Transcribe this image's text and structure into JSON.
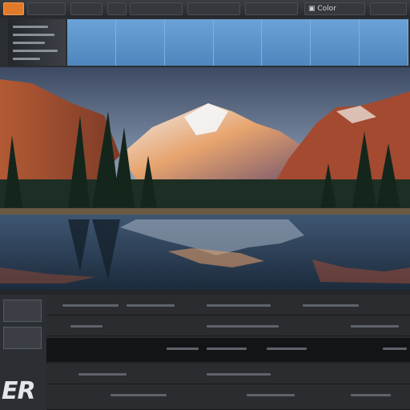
{
  "toolbar": {
    "buttons": [
      "",
      "",
      "",
      "",
      "",
      "",
      ""
    ],
    "search_label": "Color"
  },
  "viewer": {
    "image_label": ""
  },
  "bottom": {
    "logo_text": "ER",
    "row_title": ""
  },
  "colors": {
    "accent": "#e07a2a",
    "panel_blue": "#5a92c8",
    "background": "#1c1e21"
  }
}
